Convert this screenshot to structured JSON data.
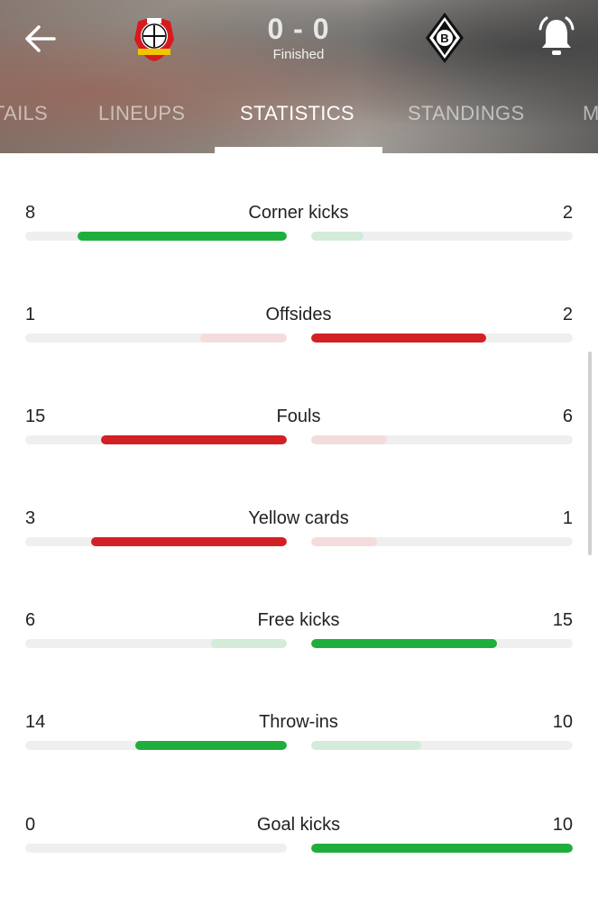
{
  "header": {
    "score": "0 - 0",
    "status": "Finished",
    "home_team_logo": "bayer-leverkusen-crest",
    "away_team_logo": "borussia-monchengladbach-crest",
    "back_icon": "arrow-left-icon",
    "alert_icon": "bell-icon"
  },
  "tabs": [
    {
      "label": "TAILS",
      "active": false
    },
    {
      "label": "LINEUPS",
      "active": false
    },
    {
      "label": "STATISTICS",
      "active": true
    },
    {
      "label": "STANDINGS",
      "active": false
    },
    {
      "label": "M",
      "active": false
    }
  ],
  "colors": {
    "green": "#1fae3c",
    "green_light": "#d3ebd8",
    "red": "#d32025",
    "red_light": "#f4dcdd",
    "track": "#efefef"
  },
  "stats": [
    {
      "label": "Corner kicks",
      "home": "8",
      "away": "2",
      "home_frac": 0.8,
      "away_frac": 0.2,
      "home_color": "green",
      "away_color": "green_light"
    },
    {
      "label": "Offsides",
      "home": "1",
      "away": "2",
      "home_frac": 0.33,
      "away_frac": 0.67,
      "home_color": "red_light",
      "away_color": "red"
    },
    {
      "label": "Fouls",
      "home": "15",
      "away": "6",
      "home_frac": 0.71,
      "away_frac": 0.29,
      "home_color": "red",
      "away_color": "red_light"
    },
    {
      "label": "Yellow cards",
      "home": "3",
      "away": "1",
      "home_frac": 0.75,
      "away_frac": 0.25,
      "home_color": "red",
      "away_color": "red_light"
    },
    {
      "label": "Free kicks",
      "home": "6",
      "away": "15",
      "home_frac": 0.29,
      "away_frac": 0.71,
      "home_color": "green_light",
      "away_color": "green"
    },
    {
      "label": "Throw-ins",
      "home": "14",
      "away": "10",
      "home_frac": 0.58,
      "away_frac": 0.42,
      "home_color": "green",
      "away_color": "green_light"
    },
    {
      "label": "Goal kicks",
      "home": "0",
      "away": "10",
      "home_frac": 0.0,
      "away_frac": 1.0,
      "home_color": "green_light",
      "away_color": "green"
    }
  ]
}
